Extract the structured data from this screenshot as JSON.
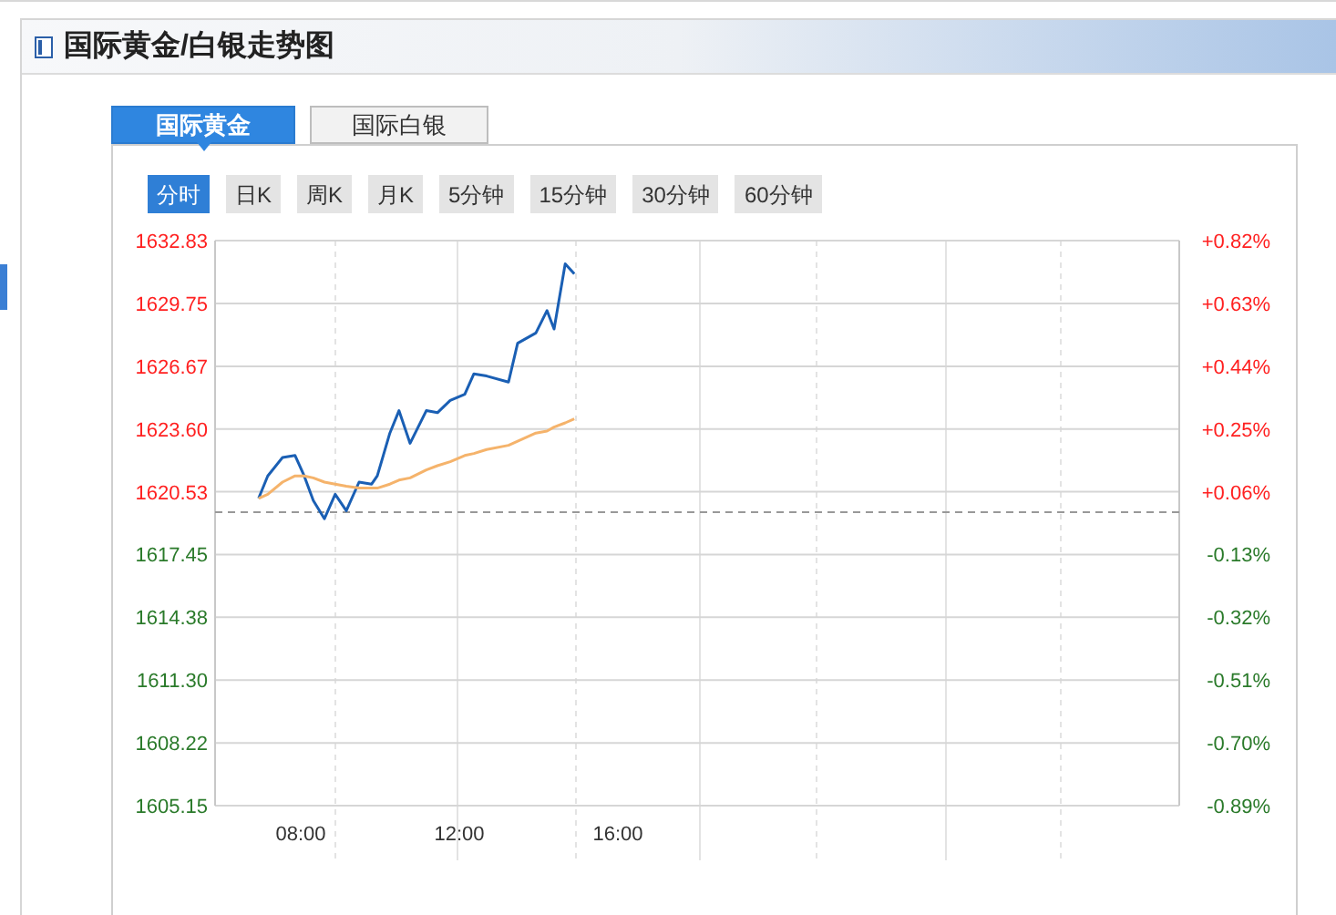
{
  "panel": {
    "title": "国际黄金/白银走势图"
  },
  "tabs": [
    {
      "label": "国际黄金",
      "selected": true
    },
    {
      "label": "国际白银",
      "selected": false
    }
  ],
  "periods": [
    {
      "label": "分时",
      "selected": true
    },
    {
      "label": "日K",
      "selected": false
    },
    {
      "label": "周K",
      "selected": false
    },
    {
      "label": "月K",
      "selected": false
    },
    {
      "label": "5分钟",
      "selected": false
    },
    {
      "label": "15分钟",
      "selected": false
    },
    {
      "label": "30分钟",
      "selected": false
    },
    {
      "label": "60分钟",
      "selected": false
    }
  ],
  "chart_data": {
    "type": "line",
    "x": [
      6.94,
      7.17,
      7.54,
      7.86,
      8.09,
      8.32,
      8.6,
      8.87,
      9.15,
      9.47,
      9.79,
      9.93,
      10.25,
      10.48,
      10.76,
      11.17,
      11.45,
      11.77,
      12.14,
      12.37,
      12.69,
      13.24,
      13.47,
      13.93,
      14.21,
      14.39,
      14.67,
      14.9
    ],
    "series": [
      {
        "color": "#1a5fb4",
        "values": [
          1620.2,
          1621.3,
          1622.2,
          1622.3,
          1621.3,
          1620.1,
          1619.2,
          1620.4,
          1619.6,
          1621.0,
          1620.9,
          1621.3,
          1623.4,
          1624.5,
          1622.9,
          1624.5,
          1624.4,
          1625.0,
          1625.3,
          1626.3,
          1626.2,
          1625.9,
          1627.8,
          1628.3,
          1629.4,
          1628.5,
          1631.7,
          1631.2
        ]
      },
      {
        "color": "#f5b36b",
        "values": [
          1620.2,
          1620.4,
          1621.0,
          1621.3,
          1621.3,
          1621.2,
          1621.0,
          1620.9,
          1620.8,
          1620.7,
          1620.7,
          1620.7,
          1620.9,
          1621.1,
          1621.2,
          1621.6,
          1621.8,
          1622.0,
          1622.3,
          1622.4,
          1622.6,
          1622.8,
          1623.0,
          1623.4,
          1623.5,
          1623.7,
          1623.9,
          1624.1
        ]
      }
    ],
    "xlim": [
      5.84,
      30.16
    ],
    "ylim": [
      1605.15,
      1632.83
    ],
    "xticks": [
      {
        "value": 8,
        "label": "08:00"
      },
      {
        "value": 12,
        "label": "12:00"
      },
      {
        "value": 16,
        "label": "16:00"
      }
    ],
    "yticks": [
      {
        "value": 1632.83,
        "label": "1632.83"
      },
      {
        "value": 1629.75,
        "label": "1629.75"
      },
      {
        "value": 1626.67,
        "label": "1626.67"
      },
      {
        "value": 1623.6,
        "label": "1623.60"
      },
      {
        "value": 1620.53,
        "label": "1620.53"
      },
      {
        "value": 1617.45,
        "label": "1617.45"
      },
      {
        "value": 1614.38,
        "label": "1614.38"
      },
      {
        "value": 1611.3,
        "label": "1611.30"
      },
      {
        "value": 1608.22,
        "label": "1608.22"
      },
      {
        "value": 1605.15,
        "label": "1605.15"
      }
    ],
    "grid": true,
    "ref_lines": [
      {
        "axis": "y",
        "value": 1619.53
      }
    ],
    "y2lim": [
      -0.89,
      0.82
    ],
    "y2ticks": [
      {
        "value": 0.82,
        "label": "+0.82%"
      },
      {
        "value": 0.63,
        "label": "+0.63%"
      },
      {
        "value": 0.44,
        "label": "+0.44%"
      },
      {
        "value": 0.25,
        "label": "+0.25%"
      },
      {
        "value": 0.06,
        "label": "+0.06%"
      },
      {
        "value": -0.13,
        "label": "-0.13%"
      },
      {
        "value": -0.32,
        "label": "-0.32%"
      },
      {
        "value": -0.51,
        "label": "-0.51%"
      },
      {
        "value": -0.7,
        "label": "-0.70%"
      },
      {
        "value": -0.89,
        "label": "-0.89%"
      }
    ]
  }
}
